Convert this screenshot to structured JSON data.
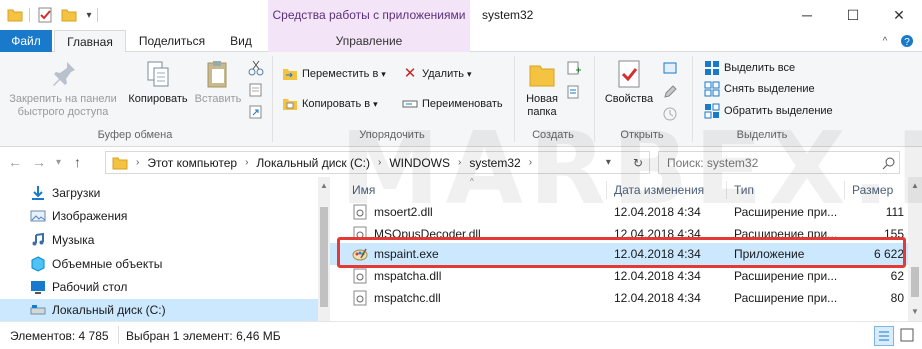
{
  "window": {
    "title": "system32",
    "tools_band": "Средства работы с приложениями",
    "minimize": "─",
    "maximize": "☐",
    "close": "✕"
  },
  "tabs": [
    "Файл",
    "Главная",
    "Поделиться",
    "Вид",
    "Управление"
  ],
  "ribbon": {
    "clipboard": {
      "pin": "Закрепить на панели быстрого доступа",
      "copy": "Копировать",
      "paste": "Вставить",
      "group": "Буфер обмена"
    },
    "organize": {
      "move": "Переместить в",
      "copy_to": "Копировать в",
      "delete": "Удалить",
      "rename": "Переименовать",
      "group": "Упорядочить"
    },
    "create": {
      "new_folder": "Новая папка",
      "group": "Создать"
    },
    "open": {
      "properties": "Свойства",
      "group": "Открыть"
    },
    "select": {
      "select_all": "Выделить все",
      "select_none": "Снять выделение",
      "invert": "Обратить выделение",
      "group": "Выделить"
    },
    "collapse": "^"
  },
  "address": {
    "crumbs": [
      "Этот компьютер",
      "Локальный диск (C:)",
      "WINDOWS",
      "system32"
    ],
    "search_placeholder": "Поиск: system32"
  },
  "nav": [
    {
      "label": "Загрузки",
      "icon": "download-arrow-icon"
    },
    {
      "label": "Изображения",
      "icon": "pictures-icon"
    },
    {
      "label": "Музыка",
      "icon": "music-icon"
    },
    {
      "label": "Объемные объекты",
      "icon": "3d-objects-icon"
    },
    {
      "label": "Рабочий стол",
      "icon": "desktop-icon"
    },
    {
      "label": "Локальный диск (C:)",
      "icon": "drive-icon"
    }
  ],
  "columns": [
    "Имя",
    "Дата изменения",
    "Тип",
    "Размер"
  ],
  "files": [
    {
      "name": "msoert2.dll",
      "date": "12.04.2018 4:34",
      "type": "Расширение при...",
      "size": "111"
    },
    {
      "name": "MSOpusDecoder.dll",
      "date": "12.04.2018 4:34",
      "type": "Расширение при...",
      "size": "155"
    },
    {
      "name": "mspaint.exe",
      "date": "12.04.2018 4:34",
      "type": "Приложение",
      "size": "6 622"
    },
    {
      "name": "mspatcha.dll",
      "date": "12.04.2018 4:34",
      "type": "Расширение при...",
      "size": "62"
    },
    {
      "name": "mspatchc.dll",
      "date": "12.04.2018 4:34",
      "type": "Расширение при...",
      "size": "80"
    }
  ],
  "status": {
    "count": "Элементов: 4 785",
    "selected": "Выбран 1 элемент: 6,46 МБ"
  },
  "watermark": "MARBEX.RU",
  "colors": {
    "accent": "#1979ca",
    "selection": "#cce8ff",
    "highlight_border": "#e53935",
    "tools_band": "#f3e5f7"
  }
}
